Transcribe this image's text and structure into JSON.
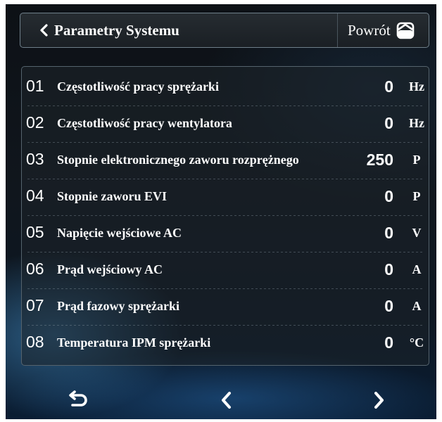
{
  "header": {
    "title": "Parametry Systemu",
    "return_label": "Powrót"
  },
  "icons": {
    "back": "chevron-left-icon",
    "return": "home-icon",
    "nav_back": "return-arrow-icon",
    "nav_prev": "chevron-left-icon",
    "nav_next": "chevron-right-icon"
  },
  "parameters": [
    {
      "num": "01",
      "name": "Częstotliwość pracy sprężarki",
      "value": "0",
      "unit": "Hz"
    },
    {
      "num": "02",
      "name": "Częstotliwość pracy wentylatora",
      "value": "0",
      "unit": "Hz"
    },
    {
      "num": "03",
      "name": "Stopnie elektronicznego zaworu rozprężnego",
      "value": "250",
      "unit": "P"
    },
    {
      "num": "04",
      "name": "Stopnie zaworu EVI",
      "value": "0",
      "unit": "P"
    },
    {
      "num": "05",
      "name": "Napięcie wejściowe AC",
      "value": "0",
      "unit": "V"
    },
    {
      "num": "06",
      "name": "Prąd wejściowy AC",
      "value": "0",
      "unit": "A"
    },
    {
      "num": "07",
      "name": "Prąd fazowy sprężarki",
      "value": "0",
      "unit": "A"
    },
    {
      "num": "08",
      "name": "Temperatura IPM sprężarki",
      "value": "0",
      "unit": "°C"
    }
  ],
  "colors": {
    "text": "#ffffff",
    "panel_border": "#55636d",
    "header_bg": "#1f2429"
  }
}
